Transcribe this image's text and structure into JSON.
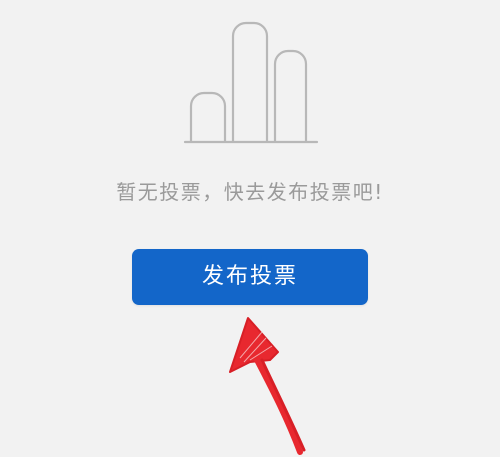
{
  "empty_state": {
    "illustration_icon": "bar-chart-outline-icon",
    "message": "暂无投票，快去发布投票吧!"
  },
  "actions": {
    "publish_label": "发布投票"
  },
  "colors": {
    "background": "#f2f2f2",
    "primary_button": "#1366c9",
    "muted_text": "#9a9a9a",
    "illustration_stroke": "#b8b8b8",
    "annotation_arrow": "#e8282f"
  }
}
